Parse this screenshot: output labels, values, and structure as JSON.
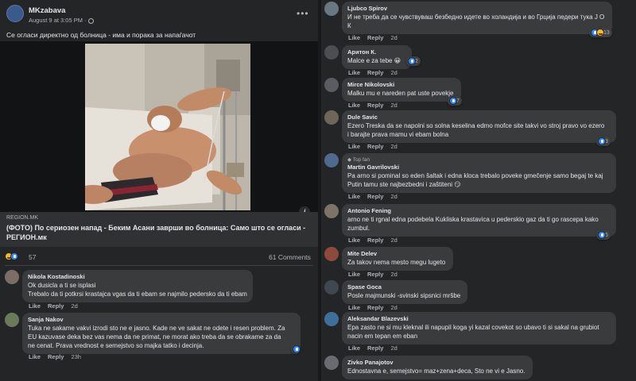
{
  "post": {
    "page_name": "MKzabava",
    "meta": "August 9 at 3:05 PM · ",
    "caption": "Се огласи директно од болница - има и порака за напаѓачот",
    "link": {
      "domain": "REGION.MK",
      "title": "(ФОТО) По сериозен напад - Беким Асани заврши во болница: Само што се огласи - РЕГИОН.мк"
    },
    "reaction_count": "57",
    "comments_count": "61 Comments"
  },
  "left_comments": [
    {
      "name": "Nikola Kostadinoski",
      "lines": [
        "Ok dusicla a ti se isplasi",
        "Trebalo da ti potkrsi krastajca vgas da ti ebam se najmilo pedersko da ti ebam"
      ],
      "like": "Like",
      "reply": "Reply",
      "time": "2d"
    },
    {
      "name": "Sanja Nakov",
      "lines": [
        "Tuka ne sakame vakvi izrodi sto ne e jasno. Kade ne ve sakat ne odete i resen problem. Za",
        "EU kazuvase deka bez vas nema da ne primat, ne morat ako treba da se obrakame za da",
        "ne cenat. Prava vrednost e semejstvo so majka tatko i decinja."
      ],
      "like": "Like",
      "reply": "Reply",
      "time": "23h",
      "reactions": "5"
    }
  ],
  "right_comments": [
    {
      "name": "Ljubco Spirov",
      "lines": [
        "И не треба да се чувствуваш безбедно идете во холандија и во Грција педери тука Ј О",
        "К"
      ],
      "like": "Like",
      "reply": "Reply",
      "time": "2d",
      "reactions": "13"
    },
    {
      "name": "Аритон К.",
      "lines": [
        "Malce e za tebe 😀"
      ],
      "like": "Like",
      "reply": "Reply",
      "time": "2d",
      "reactions": "2"
    },
    {
      "name": "Mirce Nikolovski",
      "lines": [
        "Malku mu e nareden pat uste povekje"
      ],
      "like": "Like",
      "reply": "Reply",
      "time": "2d",
      "reactions": "7"
    },
    {
      "name": "Dule Savic",
      "lines": [
        "Ezero Treska da se napolni so solna keselina edmo mofce site takvi vo stroj pravo vo ezero",
        "i barajte prava mamu vi ebam bolna"
      ],
      "like": "Like",
      "reply": "Reply",
      "time": "2d",
      "reactions": "3"
    },
    {
      "badge": "Top fan",
      "name": "Martin Gavrilovski",
      "lines": [
        "Pa arno si pominal so eden šaltak i edna kloca trebalo poveke gmečenje samo begaj te kaj",
        "Putin tamu ste najbezbedni i zaštiteni 😏"
      ],
      "like": "Like",
      "reply": "Reply",
      "time": "2d"
    },
    {
      "name": "Antonio Fening",
      "lines": [
        "arno ne ti rgnal edna podebela Kukliska krastavica u pederskio gaz da ti go rascepa kako",
        "zumbul."
      ],
      "like": "Like",
      "reply": "Reply",
      "time": "2d",
      "reactions": "6"
    },
    {
      "name": "Mite Delev",
      "lines": [
        "Za takov nema mesto megu lugeto"
      ],
      "like": "Like",
      "reply": "Reply",
      "time": "2d"
    },
    {
      "name": "Spase Goca",
      "lines": [
        "Posle majmunski -svinski sipsnici mršbe"
      ],
      "like": "Like",
      "reply": "Reply",
      "time": "2d"
    },
    {
      "name": "Aleksandar Blazevski",
      "lines": [
        "Epa zasto ne si mu kleknal ili napupil koga yi kazal covekot so ubavo ti si sakal na grubiot",
        "nacin em tepan em eban"
      ],
      "like": "Like",
      "reply": "Reply",
      "time": "2d"
    },
    {
      "name": "Zivko Panajotov",
      "lines": [
        "Ednostavna e, semejstvo= maz+zena+deca, Sto ne vi e Jasno."
      ],
      "like": "Like",
      "reply": "Reply",
      "time": "2d"
    }
  ],
  "icons": {
    "menu": "more-icon",
    "info": "info-icon",
    "like": "like-reaction-icon",
    "haha": "haha-reaction-icon"
  },
  "colors": {
    "background": "#242526",
    "bubble": "#3a3b3c",
    "like_blue": "#2d88ff",
    "haha_yellow": "#f7b928"
  }
}
